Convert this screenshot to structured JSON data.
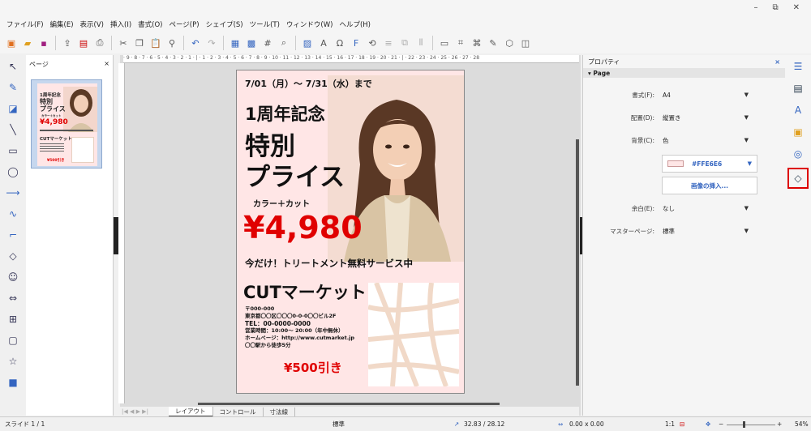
{
  "menus": [
    "ファイル(F)",
    "編集(E)",
    "表示(V)",
    "挿入(I)",
    "書式(O)",
    "ページ(P)",
    "シェイプ(S)",
    "ツール(T)",
    "ウィンドウ(W)",
    "ヘルプ(H)"
  ],
  "window_controls": {
    "minimize": "–",
    "restore": "⧉",
    "close": "✕"
  },
  "pages_panel": {
    "title": "ページ",
    "close": "×",
    "thumb_number": "1"
  },
  "ruler": {
    "h_text": "· 9 · 8 · 7 · 6 · 5 · 4 · 3 · 2 · 1 · | · 1 · 2 · 3 · 4 · 5 · 6 · 7 · 8 · 9 · 10 · 11 · 12 · 13 · 14 · 15 · 16 · 17 · 18 · 19 · 20 · 21 · | · 22 · 23 · 24 · 25 · 26 · 27 · 28"
  },
  "flyer": {
    "date": "7/01（月）～ 7/31（水）まで",
    "title1": "1周年記念",
    "title2": "特別",
    "title3": "プライス",
    "sub": "カラー＋カット",
    "price": "¥4,980",
    "promo": "今だけ！トリートメント無料サービス中",
    "brand": "CUTマーケット",
    "postal": "〒000-000",
    "address": "東京都〇〇区〇〇〇0-0-0〇〇ビル2F",
    "tel": "TEL：00-0000-0000",
    "hours": "営業時間：10:00～ 20:00（年中無休）",
    "homepage": "ホームページ：http://www.cutmarket.jp",
    "access": "〇〇駅から徒歩5分",
    "discount": "¥500引き"
  },
  "thumb": {
    "title1": "1周年記念",
    "title2": "特別",
    "title3": "プライス",
    "sub": "カラー＋カット",
    "price": "¥4,980",
    "brand": "CUTマーケット",
    "discount": "¥500引き"
  },
  "tabs": [
    "レイアウト",
    "コントロール",
    "寸法線"
  ],
  "props": {
    "title": "プロパティ",
    "close": "×",
    "section": "Page",
    "rows": [
      {
        "label": "書式(F):",
        "value": "A4"
      },
      {
        "label": "配置(D):",
        "value": "縦置き"
      },
      {
        "label": "背景(C):",
        "value": "色"
      },
      {
        "label": "余白(E):",
        "value": "なし"
      },
      {
        "label": "マスターページ:",
        "value": "標準"
      }
    ],
    "color_value": "#FFE6E6",
    "color_hex": "#ffe6e6",
    "insert_image": "画像の挿入..."
  },
  "status": {
    "slide": "スライド 1 / 1",
    "master": "標準",
    "position": "32.83 / 28.12",
    "size": "0.00 x 0.00",
    "scale": "1:1",
    "zoom": "54%"
  },
  "colors": {
    "accent_red": "#e00000",
    "page_bg": "#ffe6e6",
    "select_box": "#dd0000"
  }
}
